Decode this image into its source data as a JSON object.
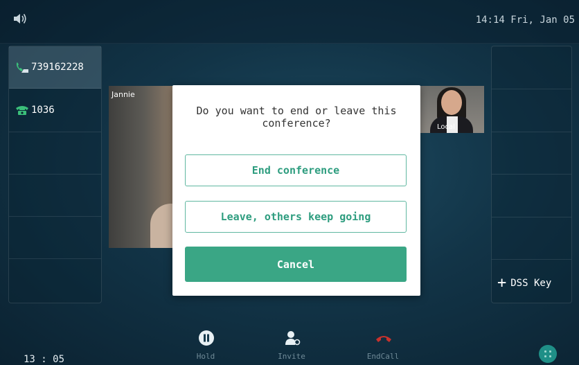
{
  "status_bar": {
    "clock": "14:14 Fri, Jan 05",
    "volume_icon": "speaker-icon"
  },
  "line_keys": [
    {
      "label": "739162228",
      "icon": "phone-call-icon"
    },
    {
      "label": "1036",
      "icon": "phone-icon"
    },
    {
      "label": ""
    },
    {
      "label": ""
    },
    {
      "label": ""
    },
    {
      "label": ""
    }
  ],
  "dss": {
    "label": "DSS Key",
    "icon": "plus-icon"
  },
  "video": {
    "remote_name": "Jannie",
    "local_label": "Local"
  },
  "dialog": {
    "message": "Do you want to end or leave this conference?",
    "end_label": "End conference",
    "leave_label": "Leave, others keep going",
    "cancel_label": "Cancel"
  },
  "bottom": {
    "call_time": "13 : 05",
    "softkeys": [
      {
        "label": "Hold",
        "icon": "pause-icon"
      },
      {
        "label": "Invite",
        "icon": "add-person-icon"
      },
      {
        "label": "EndCall",
        "icon": "end-call-icon"
      }
    ],
    "menu_icon": "menu-grid-icon"
  },
  "colors": {
    "accent": "#3aa685",
    "end_call": "#c8322d",
    "line_green": "#3bbf7a"
  }
}
